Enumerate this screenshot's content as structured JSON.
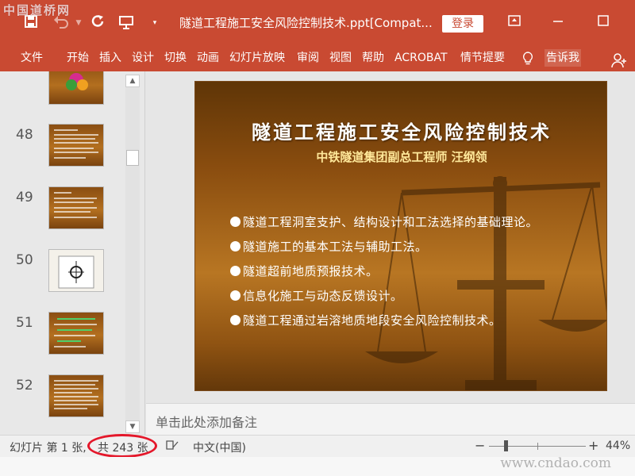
{
  "watermark": {
    "top": "中国道桥网",
    "bottom": "www.cndao.com"
  },
  "titlebar": {
    "doc_title": "隧道工程施工安全风险控制技术.ppt[Compat...",
    "login_label": "登录",
    "accent_color": "#c94a32"
  },
  "ribbon": {
    "tabs": [
      "文件",
      "开始",
      "插入",
      "设计",
      "切换",
      "动画",
      "幻灯片放映",
      "审阅",
      "视图",
      "帮助",
      "ACROBAT",
      "情节提要"
    ],
    "tell_me": "告诉我"
  },
  "thumbnails": [
    {
      "num": "48"
    },
    {
      "num": "49"
    },
    {
      "num": "50"
    },
    {
      "num": "51"
    },
    {
      "num": "52"
    }
  ],
  "slide": {
    "title": "隧道工程施工安全风险控制技术",
    "subtitle": "中铁隧道集团副总工程师 汪纲领",
    "bullets": [
      "隧道工程洞室支护、结构设计和工法选择的基础理论。",
      "隧道施工的基本工法与辅助工法。",
      "隧道超前地质预报技术。",
      "信息化施工与动态反馈设计。",
      "隧道工程通过岩溶地质地段安全风险控制技术。"
    ]
  },
  "notes": {
    "placeholder": "单击此处添加备注"
  },
  "statusbar": {
    "slide_info": "幻灯片 第 1 张,",
    "total": "共 243 张",
    "language": "中文(中国)",
    "zoom": "44%",
    "zoom_minus": "−",
    "zoom_plus": "+"
  }
}
